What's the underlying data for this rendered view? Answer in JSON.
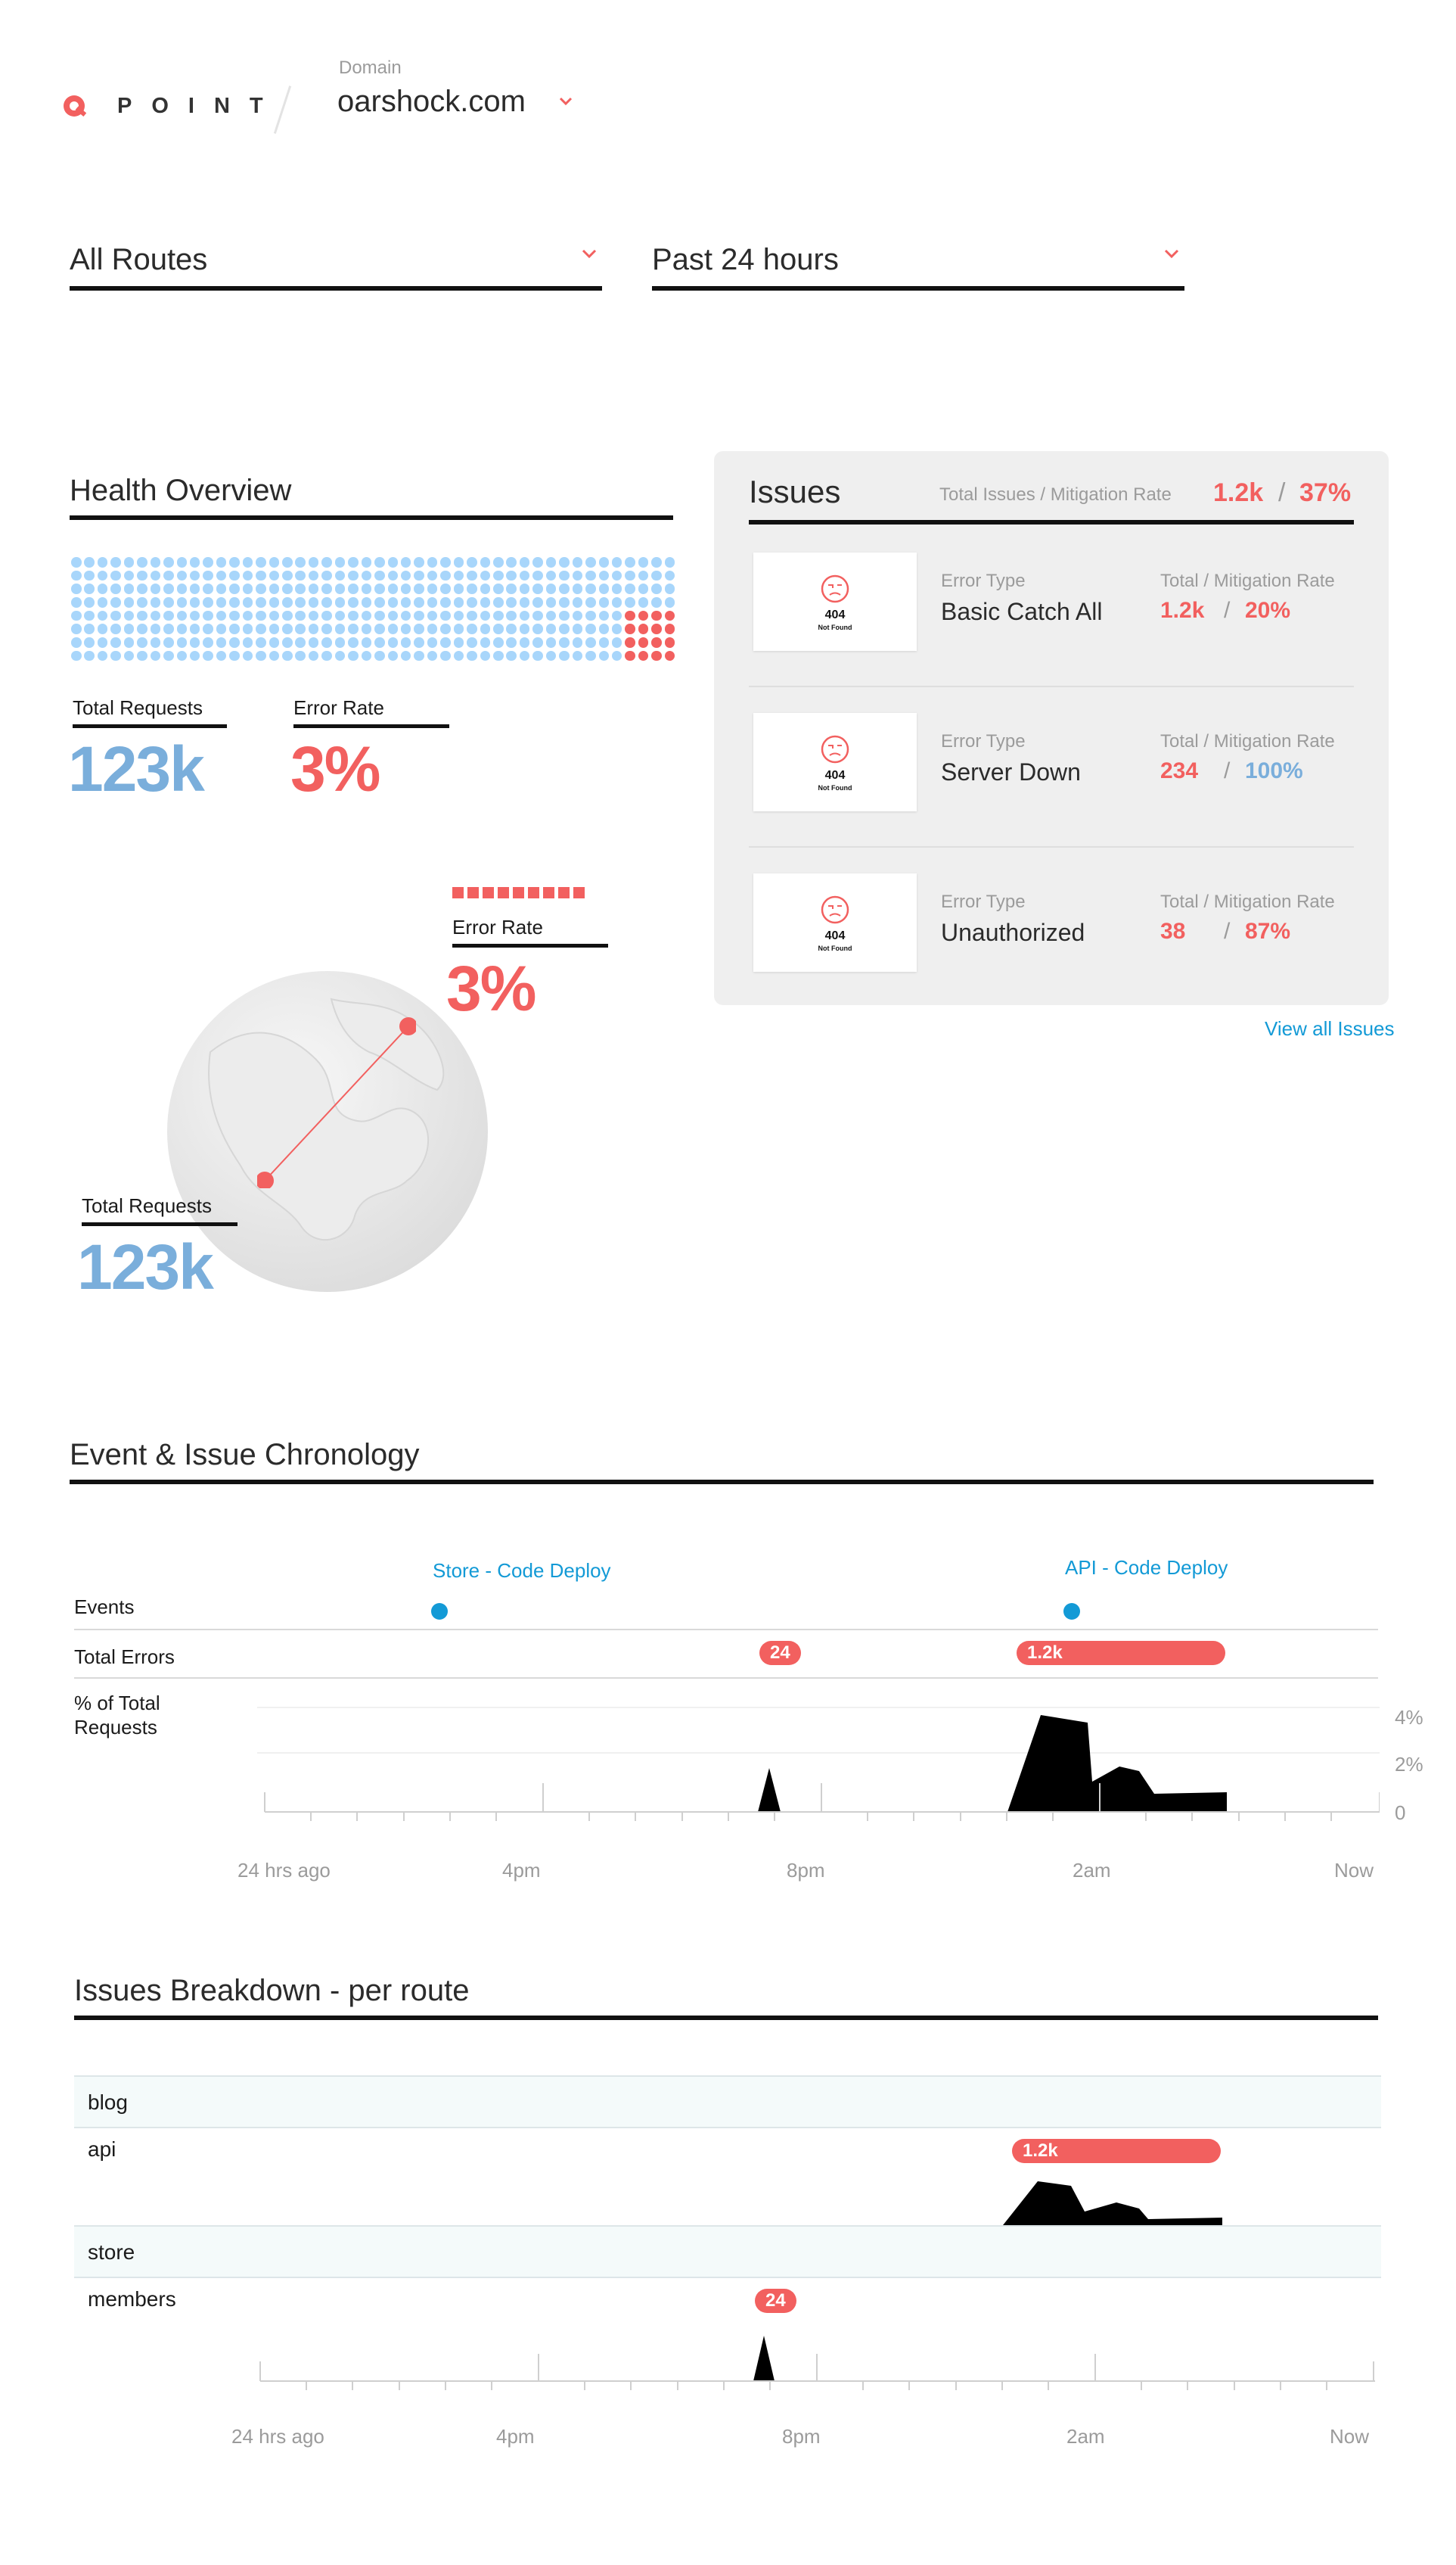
{
  "header": {
    "logo_text": "POINT",
    "domain_label": "Domain",
    "domain_value": "oarshock.com"
  },
  "filters": {
    "route_select": "All Routes",
    "time_select": "Past 24 hours"
  },
  "health": {
    "title": "Health Overview",
    "total_requests_label": "Total Requests",
    "total_requests_value": "123k",
    "error_rate_label": "Error Rate",
    "error_rate_value": "3%",
    "globe_error_rate_label": "Error Rate",
    "globe_error_rate_value": "3%",
    "globe_total_requests_label": "Total Requests",
    "globe_total_requests_value": "123k"
  },
  "issues": {
    "title": "Issues",
    "summary_labels": "Total Issues  / Mitigation Rate",
    "summary_total": "1.2k",
    "summary_sep": "/",
    "summary_rate": "37%",
    "error_type_label": "Error Type",
    "totals_label": "Total  / Mitigation Rate",
    "items": [
      {
        "name": "Basic Catch All",
        "total": "1.2k",
        "rate": "20%",
        "thumb_code": "404",
        "thumb_text": "Not Found"
      },
      {
        "name": "Server Down",
        "total": "234",
        "rate": "100%",
        "thumb_code": "404",
        "thumb_text": "Not Found"
      },
      {
        "name": "Unauthorized",
        "total": "38",
        "rate": "87%",
        "thumb_code": "404",
        "thumb_text": "Not Found"
      }
    ],
    "view_all": "View all Issues"
  },
  "chronology": {
    "title": "Event & Issue Chronology",
    "events_label": "Events",
    "total_errors_label": "Total Errors",
    "pct_label_line1": "% of Total",
    "pct_label_line2": "Requests",
    "event_1": "Store  - Code Deploy",
    "event_2": "API  - Code Deploy",
    "errors_pill_1": "24",
    "errors_pill_2": "1.2k",
    "y_ticks": [
      "4%",
      "2%",
      "0"
    ],
    "x_ticks": [
      "24 hrs ago",
      "4pm",
      "8pm",
      "2am",
      "Now"
    ]
  },
  "breakdown": {
    "title": "Issues Breakdown - per route",
    "routes": [
      "blog",
      "api",
      "store",
      "members"
    ],
    "api_pill": "1.2k",
    "members_pill": "24",
    "x_ticks": [
      "24 hrs ago",
      "4pm",
      "8pm",
      "2am",
      "Now"
    ]
  },
  "colors": {
    "accent_red": "#f2605f",
    "requests_blue": "#7aaedb",
    "dot_blue": "#a8d6fb",
    "link_blue": "#139ad6"
  }
}
